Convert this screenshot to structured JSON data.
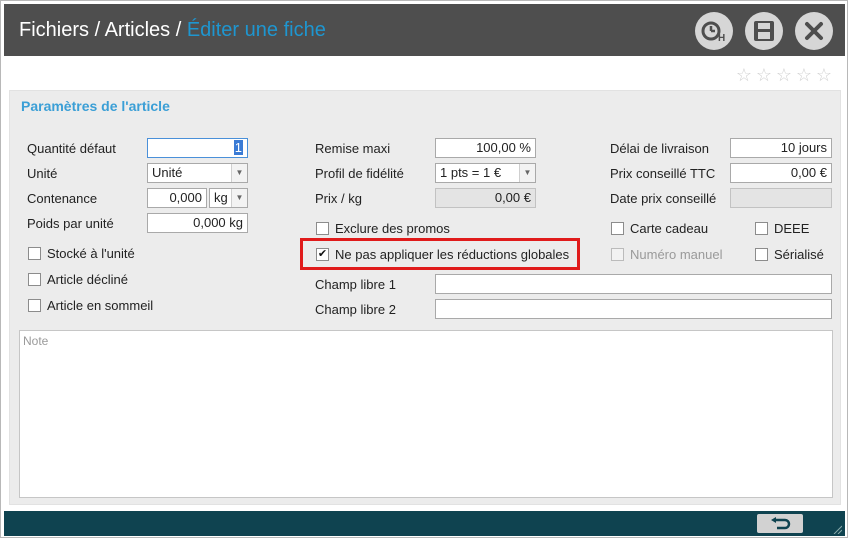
{
  "header": {
    "crumb1": "Fichiers",
    "sep1": " / ",
    "crumb2": "Articles",
    "sep2": " / ",
    "current": "Éditer une fiche",
    "history_icon_letter": "H"
  },
  "rating": {
    "stars": 5,
    "filled": 0
  },
  "section": {
    "title": "Paramètres de l'article"
  },
  "col1": {
    "quantite_label": "Quantité défaut",
    "quantite_value": "1",
    "unite_label": "Unité",
    "unite_value": "Unité",
    "contenance_label": "Contenance",
    "contenance_value": "0,000",
    "contenance_unit": "kg",
    "poids_label": "Poids par unité",
    "poids_value": "0,000 kg",
    "stocke_label": "Stocké à l'unité",
    "decline_label": "Article décliné",
    "sommeil_label": "Article en sommeil"
  },
  "col2": {
    "remise_label": "Remise maxi",
    "remise_value": "100,00 %",
    "profil_label": "Profil de fidélité",
    "profil_value": "1 pts = 1 €",
    "prixkg_label": "Prix / kg",
    "prixkg_value": "0,00 €",
    "exclure_label": "Exclure des promos",
    "nepas_label": "Ne pas appliquer les réductions globales",
    "nepas_checked": "✔",
    "champ1_label": "Champ libre 1",
    "champ1_value": "",
    "champ2_label": "Champ libre 2",
    "champ2_value": ""
  },
  "col3": {
    "delai_label": "Délai de livraison",
    "delai_value": "10 jours",
    "prixttc_label": "Prix conseillé TTC",
    "prixttc_value": "0,00 €",
    "dateprix_label": "Date prix conseillé",
    "dateprix_value": "",
    "cadeau_label": "Carte cadeau",
    "deee_label": "DEEE",
    "numero_label": "Numéro manuel",
    "serialise_label": "Sérialisé"
  },
  "note": {
    "placeholder": "Note",
    "value": ""
  },
  "colors": {
    "accent": "#1e96d0",
    "title_bg": "#4e4e4e",
    "footer_bg": "#0f4350",
    "highlight": "#e01b1b"
  }
}
